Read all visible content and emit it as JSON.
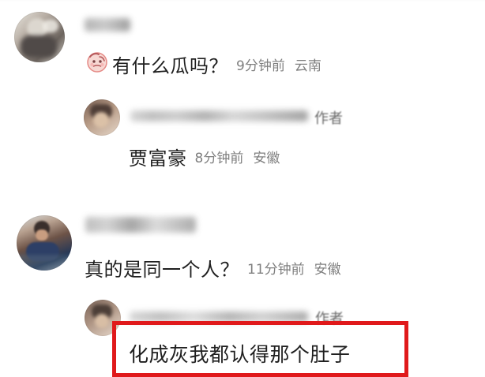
{
  "comments": [
    {
      "text": "有什么瓜吗？",
      "time": "9分钟前",
      "location": "云南",
      "reply": {
        "author_tag": "作者",
        "text": "贾富豪",
        "time": "8分钟前",
        "location": "安徽"
      }
    },
    {
      "text": "真的是同一个人？",
      "time": "11分钟前",
      "location": "安徽",
      "reply": {
        "author_tag": "作者",
        "text": "化成灰我都认得那个肚子"
      }
    }
  ],
  "icons": {
    "emoji": "face-emoji-icon"
  },
  "colors": {
    "highlight": "#e0191b",
    "meta_text": "#7f7f7f",
    "primary_text": "#1f1f1f"
  }
}
